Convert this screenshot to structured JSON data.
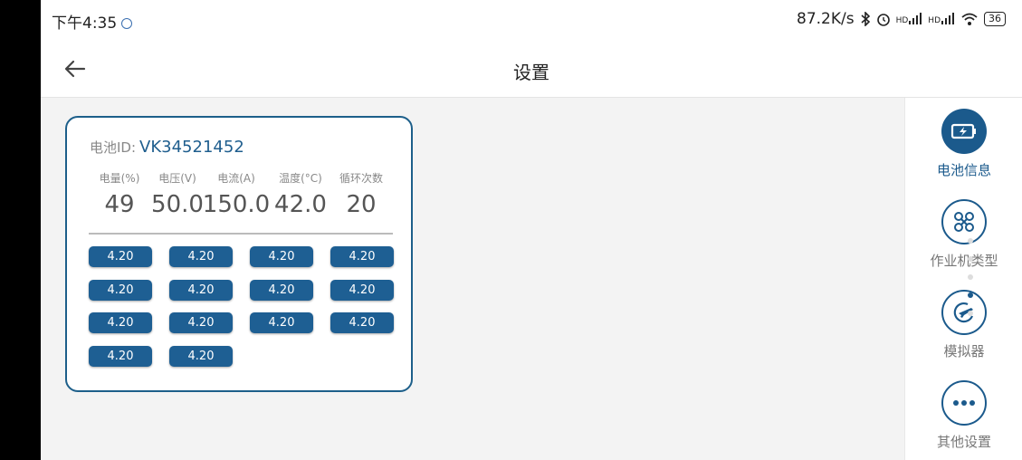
{
  "status": {
    "time": "下午4:35",
    "speed": "87.2K/s",
    "network_1": "HD",
    "network_2": "HD",
    "battery": "36"
  },
  "appbar": {
    "title": "设置"
  },
  "battery_card": {
    "id_label": "电池ID:",
    "id_value": "VK34521452",
    "stats": [
      {
        "label": "电量(%)",
        "value": "49"
      },
      {
        "label": "电压(V)",
        "value": "50.0"
      },
      {
        "label": "电流(A)",
        "value": "150.0"
      },
      {
        "label": "温度(°C)",
        "value": "42.0"
      },
      {
        "label": "循环次数",
        "value": "20"
      }
    ],
    "cells": [
      "4.20",
      "4.20",
      "4.20",
      "4.20",
      "4.20",
      "4.20",
      "4.20",
      "4.20",
      "4.20",
      "4.20",
      "4.20",
      "4.20",
      "4.20",
      "4.20"
    ]
  },
  "sidebar": {
    "items": [
      {
        "label": "电池信息",
        "icon": "battery-charging-icon",
        "active": true
      },
      {
        "label": "作业机类型",
        "icon": "drone-icon",
        "active": false
      },
      {
        "label": "模拟器",
        "icon": "plane-icon",
        "active": false
      },
      {
        "label": "其他设置",
        "icon": "more-icon",
        "active": false
      }
    ]
  },
  "pager": {
    "count": 5,
    "current": 4
  },
  "colors": {
    "accent": "#1b5a8c",
    "cell_bg": "#1e5f93",
    "background": "#f3f3f3"
  }
}
